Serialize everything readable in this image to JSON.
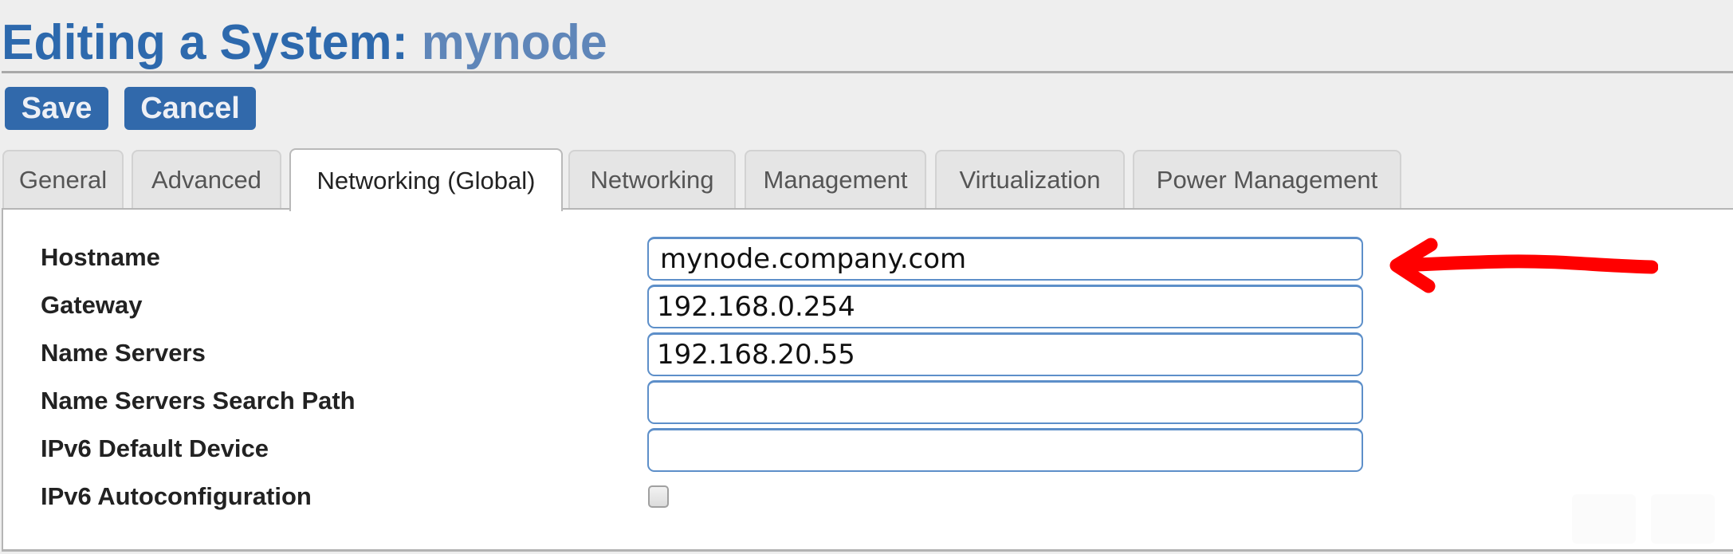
{
  "header": {
    "title_prefix": "Editing a System: ",
    "title_name": "mynode"
  },
  "toolbar": {
    "save_label": "Save",
    "cancel_label": "Cancel"
  },
  "tabs": [
    {
      "label": "General",
      "active": false
    },
    {
      "label": "Advanced",
      "active": false
    },
    {
      "label": "Networking (Global)",
      "active": true
    },
    {
      "label": "Networking",
      "active": false
    },
    {
      "label": "Management",
      "active": false
    },
    {
      "label": "Virtualization",
      "active": false
    },
    {
      "label": "Power Management",
      "active": false
    }
  ],
  "form": {
    "hostname": {
      "label": "Hostname",
      "value": "mynode.company.com"
    },
    "gateway": {
      "label": "Gateway",
      "value": "192.168.0.254"
    },
    "name_servers": {
      "label": "Name Servers",
      "value": "192.168.20.55"
    },
    "name_servers_search_path": {
      "label": "Name Servers Search Path",
      "value": ""
    },
    "ipv6_default_device": {
      "label": "IPv6 Default Device",
      "value": ""
    },
    "ipv6_autoconfiguration": {
      "label": "IPv6 Autoconfiguration",
      "checked": false
    }
  },
  "annotation": {
    "icon": "red-arrow-icon",
    "color": "#ff0000",
    "points_to": "hostname"
  },
  "colors": {
    "title": "#2d69ad",
    "title_name": "#5f86b9",
    "button": "#3169ab",
    "input_border": "#5d8fc9"
  }
}
